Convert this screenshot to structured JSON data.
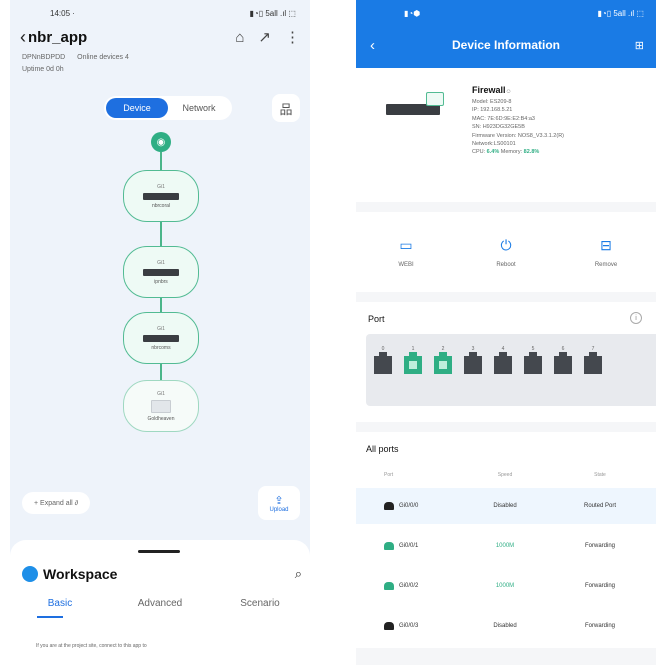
{
  "left": {
    "status_time": "14:05 ·",
    "status_right": "▮◔▯ 5all .ıl ⬚",
    "back_glyph": "‹",
    "app_title": "nbr_app",
    "header_icons": {
      "home": "⌂",
      "share": "↗",
      "more": "⋮"
    },
    "meta": {
      "project": "DPNnBDPDD",
      "online": "Online devices 4",
      "uptime": "Uptime 0d 0h"
    },
    "segment": {
      "device": "Device",
      "network": "Network"
    },
    "topo_icon": "品",
    "gateway_icon": "◉",
    "nodes": [
      {
        "port": "Gi1",
        "name": "nbrcoral"
      },
      {
        "port": "Gi1",
        "name": "ipnbrs"
      },
      {
        "port": "Gi1",
        "name": "nbrcoms"
      },
      {
        "port": "Gi1",
        "name": "Goldheaven"
      }
    ],
    "expand_label": "+ Expand all  ∂",
    "upload_icon": "⇪",
    "upload_label": "Upload",
    "workspace": {
      "title": "Workspace",
      "search_icon": "⌕",
      "tabs": [
        "Basic",
        "Advanced",
        "Scenario"
      ],
      "note": "If you are at the project site, connect to  this app  to"
    }
  },
  "right": {
    "status_left": "▮◔⬢",
    "status_right": "▮◔▯ 5all .ıl ⬚",
    "back_glyph": "‹",
    "title": "Device Information",
    "more_icon": "⊞",
    "device": {
      "name": "Firewall",
      "name_suffix": "☺",
      "model": "Model: ES209-8",
      "ip": "IP: 192.168.5.21",
      "mac": "MAC: 7E:6D:9E:E2:B4:a3",
      "sn": "SN: H923DG32GE5B",
      "firmware": "Firmware Version: NOS8_V3.3.1.2(R)",
      "network": "Network:LS00101",
      "cpu_label": "CPU:",
      "cpu": "6.4%",
      "memory_label": "Memory:",
      "memory": "82.8%"
    },
    "actions": [
      {
        "icon": "▭",
        "label": "WEBI"
      },
      {
        "icon": "⏻",
        "label": "Reboot"
      },
      {
        "icon": "⊟",
        "label": "Remove"
      }
    ],
    "ports": {
      "title": "Port",
      "info_icon": "i",
      "items": [
        {
          "num": "0",
          "up": false
        },
        {
          "num": "1",
          "up": true
        },
        {
          "num": "2",
          "up": true
        },
        {
          "num": "3",
          "up": false
        },
        {
          "num": "4",
          "up": false
        },
        {
          "num": "5",
          "up": false
        },
        {
          "num": "6",
          "up": false
        },
        {
          "num": "7",
          "up": false
        }
      ]
    },
    "all_ports": {
      "title": "All ports",
      "headers": [
        "Port",
        "Speed",
        "State"
      ],
      "rows": [
        {
          "port": "Gi0/0/0",
          "speed": "Disabled",
          "state": "Routed Port",
          "up": false
        },
        {
          "port": "Gi0/0/1",
          "speed": "1000M",
          "state": "Forwarding",
          "up": true
        },
        {
          "port": "Gi0/0/2",
          "speed": "1000M",
          "state": "Forwarding",
          "up": true
        },
        {
          "port": "Gi0/0/3",
          "speed": "Disabled",
          "state": "Forwarding",
          "up": false
        }
      ]
    }
  }
}
